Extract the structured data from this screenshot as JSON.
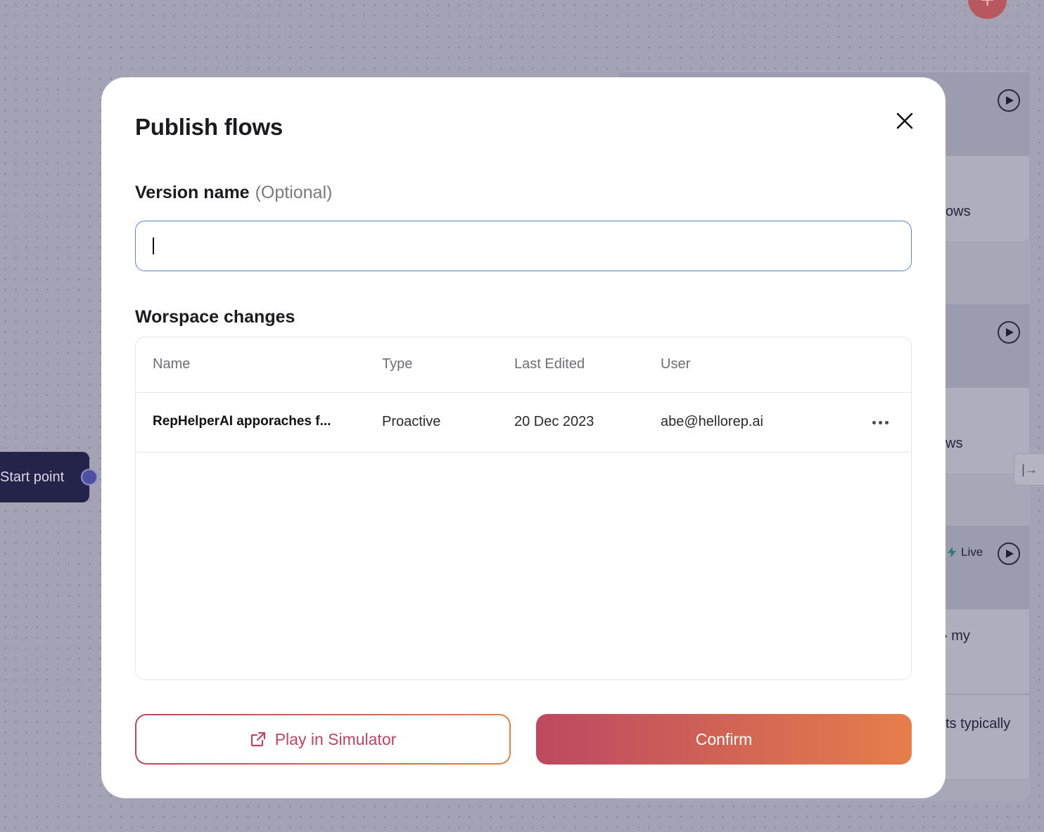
{
  "background": {
    "start_node_label": "Start point",
    "card_snippets": [
      "ows",
      "ws",
      "› my",
      "ts typically"
    ],
    "live_label": "Live",
    "icons": {
      "add": "plus-icon",
      "play": "play-icon",
      "live": "lightning-icon",
      "collapse": "collapse-panel-icon"
    }
  },
  "modal": {
    "title": "Publish flows",
    "version_label": "Version name",
    "version_optional": "(Optional)",
    "version_value": "",
    "version_placeholder": "",
    "changes_title": "Worspace changes",
    "table": {
      "columns": [
        "Name",
        "Type",
        "Last Edited",
        "User"
      ],
      "rows": [
        {
          "name": "RepHelperAI apporaches f...",
          "type": "Proactive",
          "last_edited": "20 Dec 2023",
          "user": "abe@hellorep.ai"
        }
      ]
    },
    "buttons": {
      "simulator_label": "Play in Simulator",
      "confirm_label": "Confirm"
    }
  },
  "colors": {
    "accent_start": "#bd4860",
    "accent_end": "#e57e4a",
    "input_focus_border": "#5d86c7",
    "overlay": "#a3a3b5"
  }
}
